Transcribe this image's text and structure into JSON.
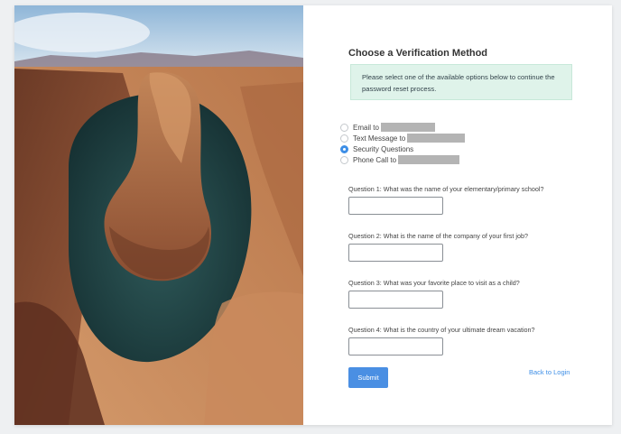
{
  "form": {
    "title": "Choose a Verification Method",
    "info_text": "Please select one of the available options below to continue the password reset process."
  },
  "methods": [
    {
      "label": "Email to",
      "selected": false
    },
    {
      "label": "Text Message to",
      "selected": false
    },
    {
      "label": "Security Questions",
      "selected": true
    },
    {
      "label": "Phone Call to",
      "selected": false
    }
  ],
  "questions": [
    {
      "label": "Question 1: What was the name of your elementary/primary school?",
      "value": ""
    },
    {
      "label": "Question 2: What is the name of the company of your first job?",
      "value": ""
    },
    {
      "label": "Question 3: What was your favorite place to visit as a child?",
      "value": ""
    },
    {
      "label": "Question 4: What is the country of your ultimate dream vacation?",
      "value": ""
    }
  ],
  "actions": {
    "submit_label": "Submit",
    "back_label": "Back to Login"
  },
  "colors": {
    "accent": "#4a8fe3",
    "info_background": "#dff3ea"
  }
}
